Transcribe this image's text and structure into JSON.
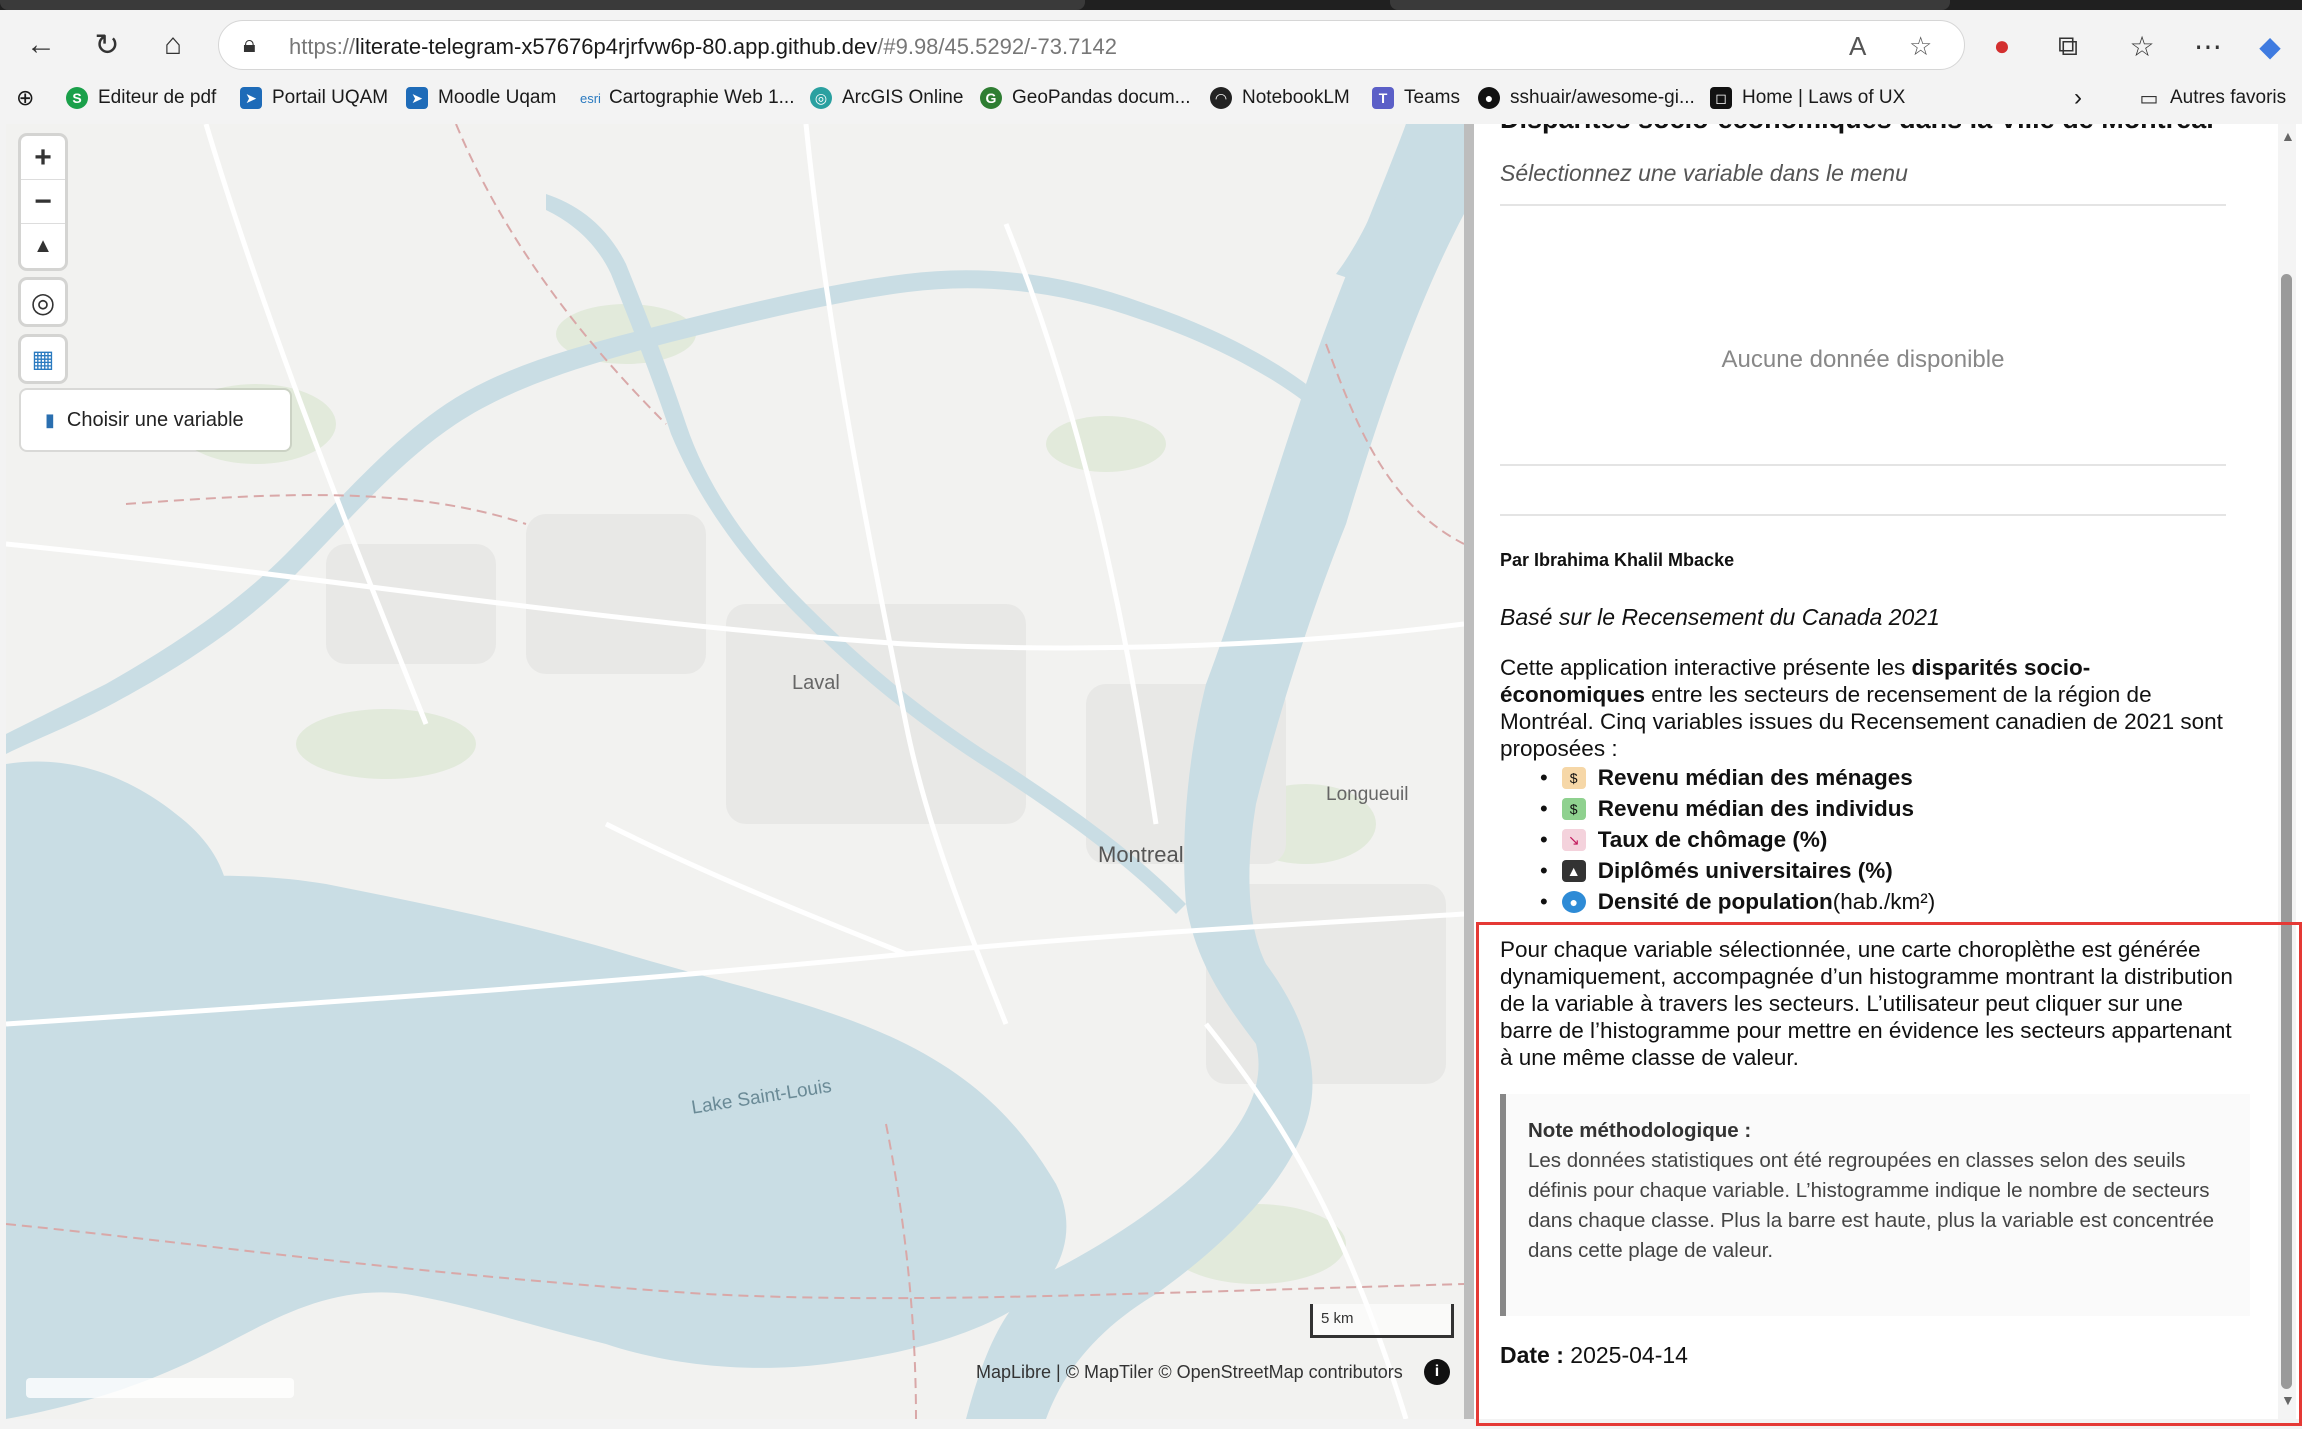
{
  "browser": {
    "url_prefix": "https://",
    "url_host": "literate-telegram-x57676p4rjrfvw6p-80.app.github.dev",
    "url_rest": "/#9.98/45.5292/-73.7142",
    "bookmarks": [
      "Editeur de pdf",
      "Portail UQAM",
      "Moodle Uqam",
      "Cartographie Web 1...",
      "ArcGIS Online",
      "GeoPandas docum...",
      "NotebookLM",
      "Teams",
      "sshuair/awesome-gi...",
      "Home | Laws of UX"
    ],
    "other_favorites": "Autres favoris"
  },
  "map": {
    "choose_variable_label": "Choisir une variable",
    "labels": {
      "laval": "Laval",
      "montreal": "Montreal",
      "longueuil": "Longueuil",
      "lake": "Lake Saint-Louis"
    },
    "scale_label": "5 km",
    "attribution": "MapLibre | © MapTiler © OpenStreetMap contributors",
    "colors": {
      "land": "#f2f2f0",
      "water": "#c9dde4",
      "park": "#dfe8d6",
      "road": "#ffffff"
    }
  },
  "panel": {
    "title": "Disparités socio-économiques dans la Ville de Montréal",
    "subtitle": "Sélectionnez une variable dans le menu",
    "no_data": "Aucune donnée disponible",
    "author": "Par Ibrahima Khalil Mbacke",
    "based_on": "Basé sur le Recensement du Canada 2021",
    "intro_before": "Cette application interactive présente les ",
    "intro_bold": "disparités socio-économiques",
    "intro_after": " entre les secteurs de recensement de la région de Montréal. Cinq variables issues du Recensement canadien de 2021 sont proposées :",
    "variables": [
      {
        "icon": "money-bag-icon",
        "label": "Revenu médian des ménages",
        "suffix": ""
      },
      {
        "icon": "banknote-icon",
        "label": "Revenu médian des individus",
        "suffix": ""
      },
      {
        "icon": "chart-down-icon",
        "label": "Taux de chômage (%)",
        "suffix": ""
      },
      {
        "icon": "graduation-cap-icon",
        "label": "Diplômés universitaires (%)",
        "suffix": ""
      },
      {
        "icon": "globe-icon",
        "label": "Densité de population",
        "suffix": " (hab./km²)"
      }
    ],
    "paragraph2": "Pour chaque variable sélectionnée, une carte choroplèthe est générée dynamiquement, accompagnée d’un histogramme montrant la distribution de la variable à travers les secteurs. L’utilisateur peut cliquer sur une barre de l’histogramme pour mettre en évidence les secteurs appartenant à une même classe de valeur.",
    "note_title": "Note méthodologique :",
    "note_body": "Les données statistiques ont été regroupées en classes selon des seuils définis pour chaque variable. L’histogramme indique le nombre de secteurs dans chaque classe. Plus la barre est haute, plus la variable est concentrée dans cette plage de valeur.",
    "date_label": "Date :",
    "date_value": " 2025-04-14"
  }
}
